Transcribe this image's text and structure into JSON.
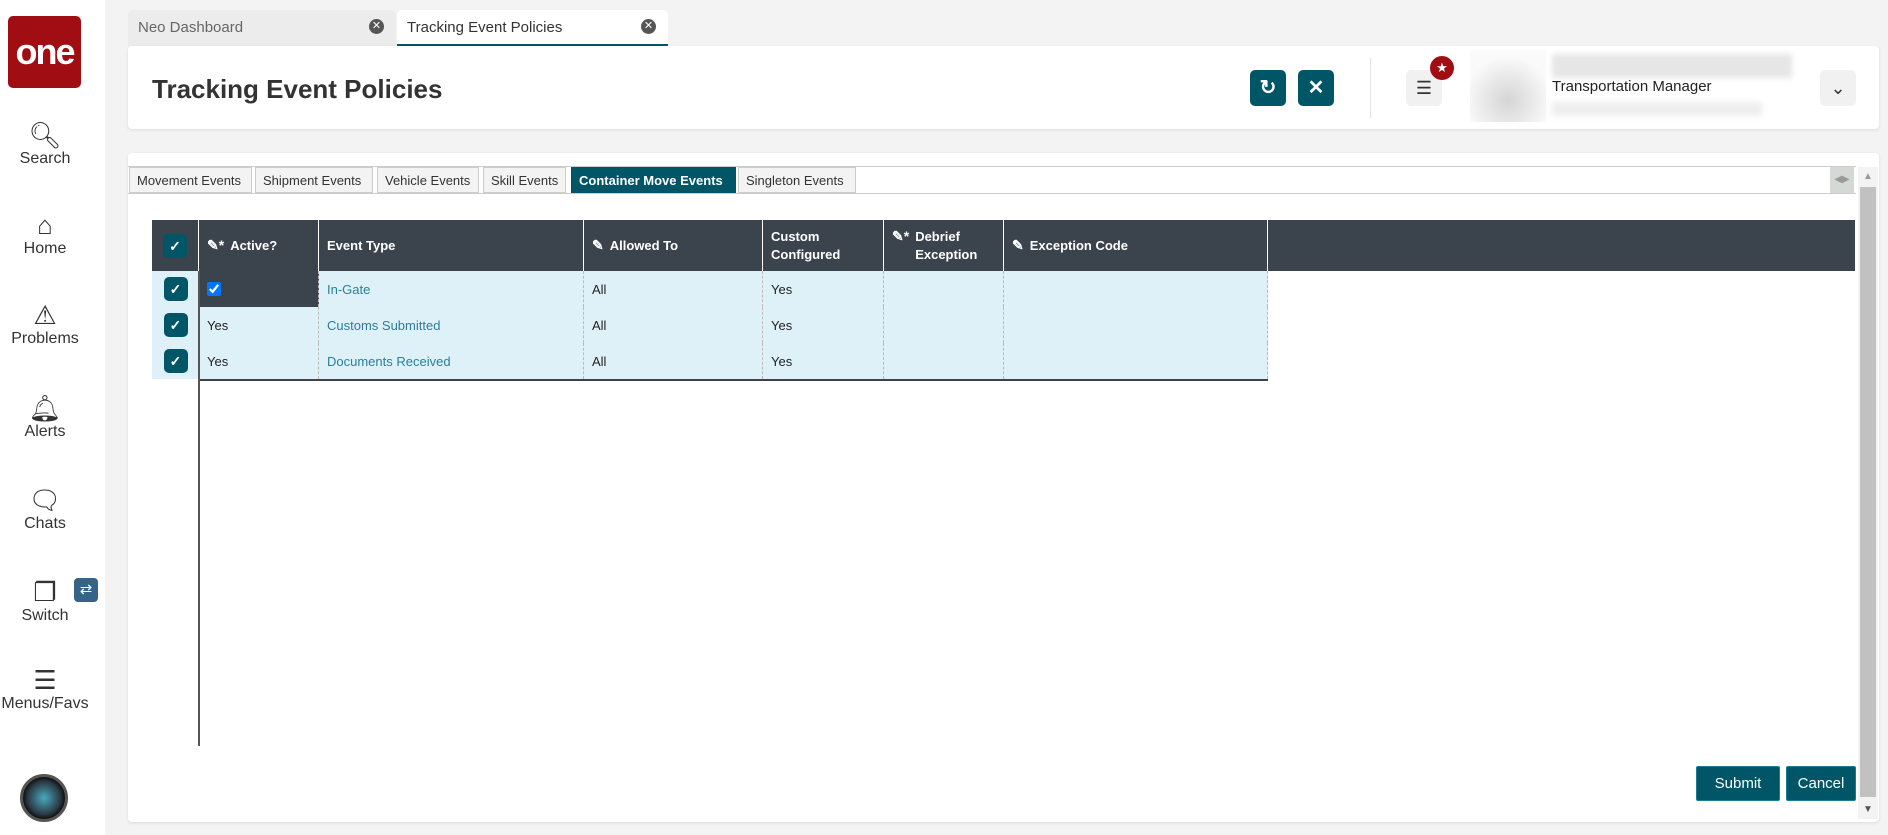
{
  "sidebar": {
    "logo": "one",
    "items": [
      {
        "label": "Search",
        "icon": "search-icon"
      },
      {
        "label": "Home",
        "icon": "home-icon"
      },
      {
        "label": "Problems",
        "icon": "warning-icon"
      },
      {
        "label": "Alerts",
        "icon": "bell-icon"
      },
      {
        "label": "Chats",
        "icon": "chat-icon"
      },
      {
        "label": "Switch",
        "icon": "switch-icon"
      },
      {
        "label": "Menus/Favs",
        "icon": "menu-icon"
      }
    ]
  },
  "tabs": [
    {
      "label": "Neo Dashboard",
      "active": false
    },
    {
      "label": "Tracking Event Policies",
      "active": true
    }
  ],
  "header": {
    "title": "Tracking Event Policies",
    "user_role": "Transportation Manager"
  },
  "subtabs": [
    "Movement Events",
    "Shipment Events",
    "Vehicle Events",
    "Skill Events",
    "Container Move Events",
    "Singleton Events"
  ],
  "active_subtab": "Container Move Events",
  "grid": {
    "columns": [
      "Active?",
      "Event Type",
      "Allowed To",
      "Custom Configured",
      "Debrief Exception",
      "Exception Code"
    ],
    "rows": [
      {
        "active": "",
        "active_checked": true,
        "event_type": "In-Gate",
        "allowed_to": "All",
        "custom": "Yes",
        "debrief": "",
        "exception_code": ""
      },
      {
        "active": "Yes",
        "event_type": "Customs Submitted",
        "allowed_to": "All",
        "custom": "Yes",
        "debrief": "",
        "exception_code": ""
      },
      {
        "active": "Yes",
        "event_type": "Documents Received",
        "allowed_to": "All",
        "custom": "Yes",
        "debrief": "",
        "exception_code": ""
      }
    ]
  },
  "footer": {
    "submit": "Submit",
    "cancel": "Cancel"
  },
  "colors": {
    "accent": "#005566",
    "brand": "#a00d12",
    "row_bg": "#def1f8",
    "header_bg": "#3b434c"
  }
}
